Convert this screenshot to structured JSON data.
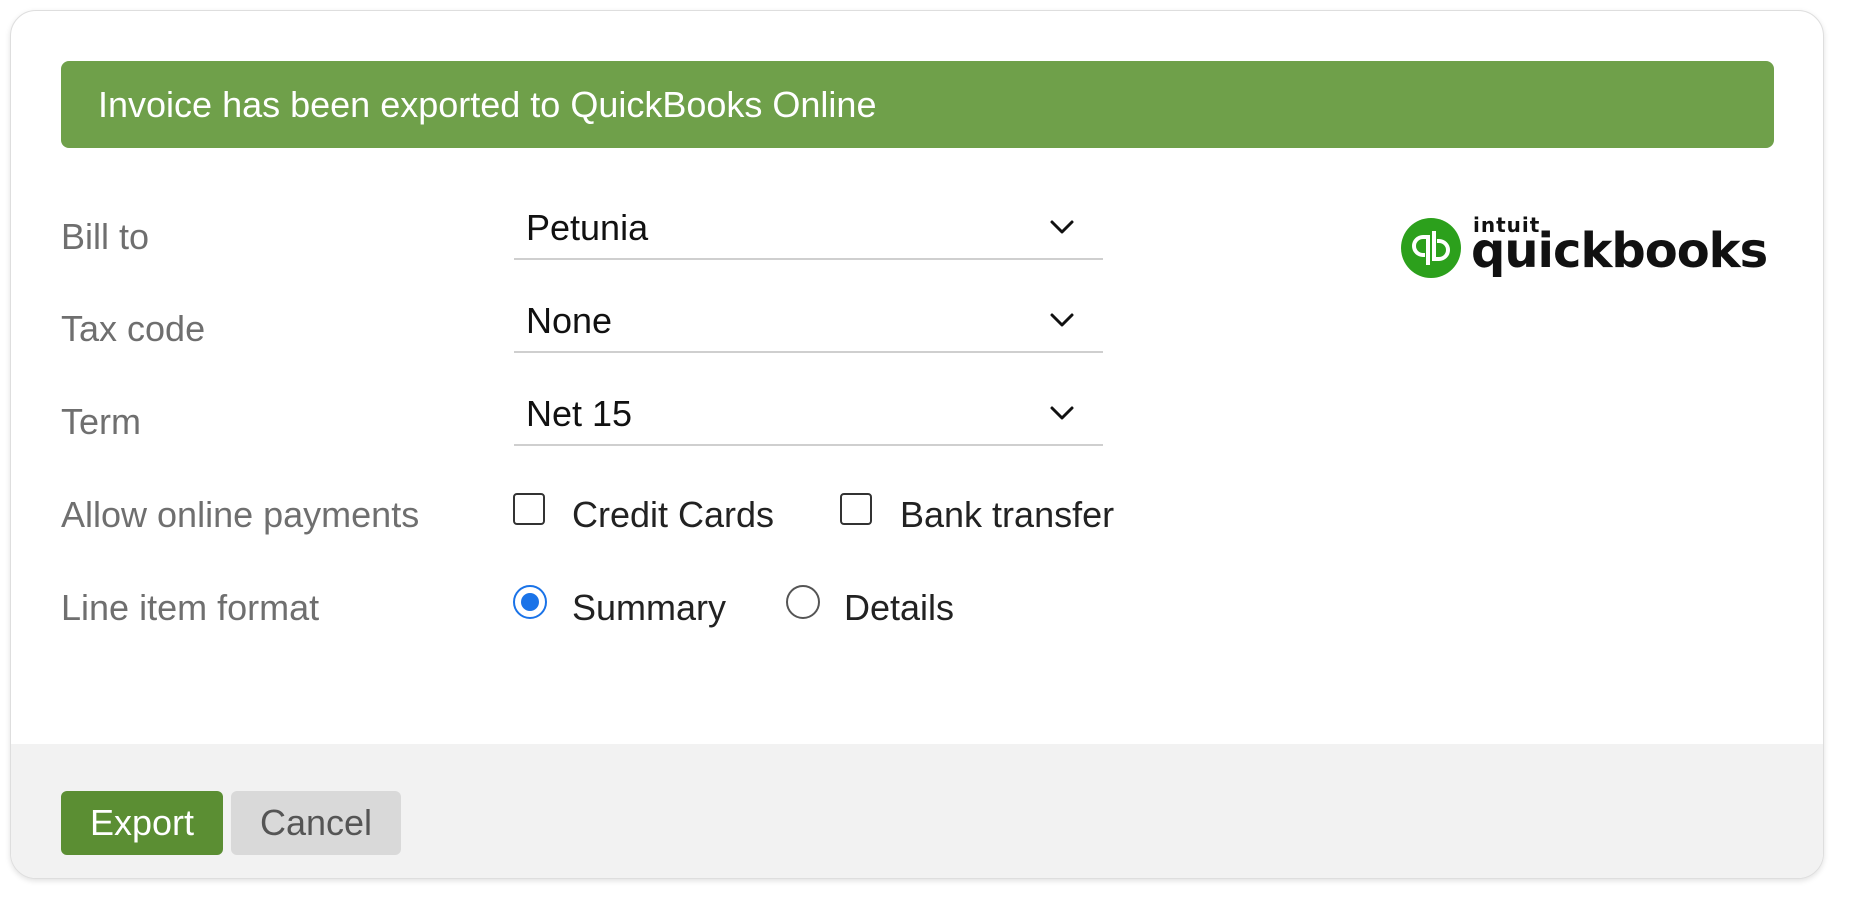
{
  "banner": {
    "message": "Invoice has been exported to QuickBooks Online"
  },
  "form": {
    "bill_to": {
      "label": "Bill to",
      "value": "Petunia"
    },
    "tax_code": {
      "label": "Tax code",
      "value": "None"
    },
    "term": {
      "label": "Term",
      "value": "Net 15"
    },
    "online_payments": {
      "label": "Allow online payments",
      "credit_cards": {
        "label": "Credit Cards",
        "checked": false
      },
      "bank_transfer": {
        "label": "Bank transfer",
        "checked": false
      }
    },
    "line_item_format": {
      "label": "Line item format",
      "summary": {
        "label": "Summary",
        "checked": true
      },
      "details": {
        "label": "Details",
        "checked": false
      }
    }
  },
  "logo": {
    "brand_small": "intuit",
    "brand_large": "quickbooks",
    "icon": "qb-circle-icon"
  },
  "footer": {
    "export_label": "Export",
    "cancel_label": "Cancel"
  },
  "colors": {
    "banner_green": "#6fa04a",
    "export_green": "#5b8e33",
    "quickbooks_green": "#2ca01c",
    "radio_blue": "#1a73e8"
  }
}
